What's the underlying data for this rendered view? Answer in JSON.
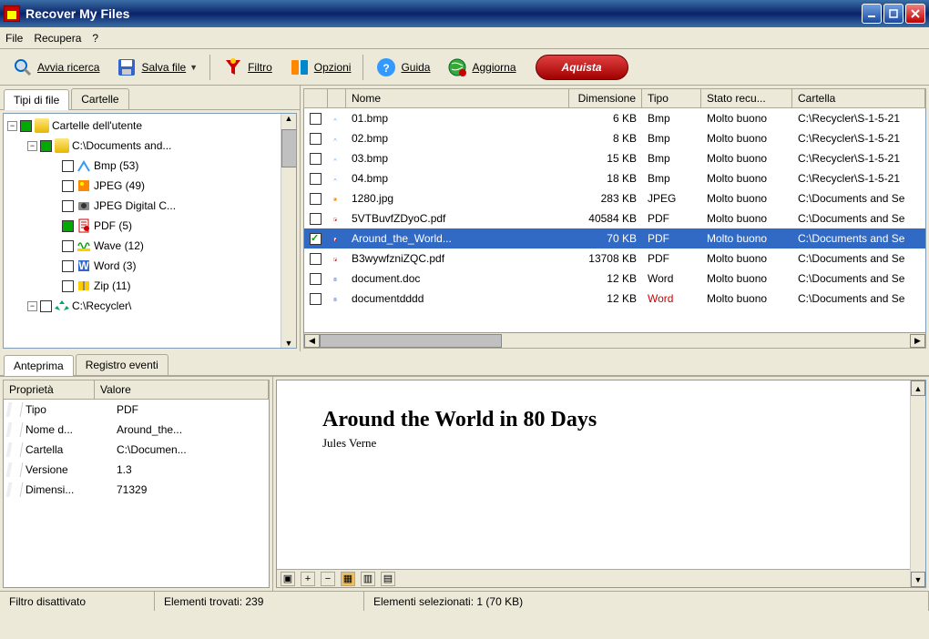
{
  "window": {
    "title": "Recover My Files"
  },
  "menu": {
    "file": "File",
    "recupera": "Recupera",
    "help": "?"
  },
  "toolbar": {
    "avvia": "Avvia ricerca",
    "salva": "Salva file",
    "filtro": "Filtro",
    "opzioni": "Opzioni",
    "guida": "Guida",
    "aggiorna": "Aggiorna",
    "aquista": "Aquista"
  },
  "left_tabs": {
    "tipi": "Tipi di file",
    "cartelle": "Cartelle"
  },
  "tree": {
    "root": "Cartelle dell'utente",
    "docs": "C:\\Documents and...",
    "bmp": "Bmp (53)",
    "jpeg": "JPEG (49)",
    "jpegd": "JPEG Digital C...",
    "pdf": "PDF (5)",
    "wave": "Wave (12)",
    "word": "Word (3)",
    "zip": "Zip (11)",
    "recycler": "C:\\Recycler\\"
  },
  "list_headers": {
    "nome": "Nome",
    "dim": "Dimensione",
    "tipo": "Tipo",
    "stato": "Stato recu...",
    "cartella": "Cartella"
  },
  "files": [
    {
      "name": "01.bmp",
      "size": "6 KB",
      "type": "Bmp",
      "state": "Molto buono",
      "folder": "C:\\Recycler\\S-1-5-21"
    },
    {
      "name": "02.bmp",
      "size": "8 KB",
      "type": "Bmp",
      "state": "Molto buono",
      "folder": "C:\\Recycler\\S-1-5-21"
    },
    {
      "name": "03.bmp",
      "size": "15 KB",
      "type": "Bmp",
      "state": "Molto buono",
      "folder": "C:\\Recycler\\S-1-5-21"
    },
    {
      "name": "04.bmp",
      "size": "18 KB",
      "type": "Bmp",
      "state": "Molto buono",
      "folder": "C:\\Recycler\\S-1-5-21"
    },
    {
      "name": "1280.jpg",
      "size": "283 KB",
      "type": "JPEG",
      "state": "Molto buono",
      "folder": "C:\\Documents and Se"
    },
    {
      "name": "5VTBuvfZDyoC.pdf",
      "size": "40584 KB",
      "type": "PDF",
      "state": "Molto buono",
      "folder": "C:\\Documents and Se"
    },
    {
      "name": "Around_the_World...",
      "size": "70 KB",
      "type": "PDF",
      "state": "Molto buono",
      "folder": "C:\\Documents and Se"
    },
    {
      "name": "B3wywfzniZQC.pdf",
      "size": "13708 KB",
      "type": "PDF",
      "state": "Molto buono",
      "folder": "C:\\Documents and Se"
    },
    {
      "name": "document.doc",
      "size": "12 KB",
      "type": "Word",
      "state": "Molto buono",
      "folder": "C:\\Documents and Se"
    },
    {
      "name": "documentdddd",
      "size": "12 KB",
      "type": "Word",
      "state": "Molto buono",
      "folder": "C:\\Documents and Se"
    }
  ],
  "bottom_tabs": {
    "anteprima": "Anteprima",
    "registro": "Registro eventi"
  },
  "prop_headers": {
    "prop": "Proprietà",
    "val": "Valore"
  },
  "props": [
    {
      "k": "Tipo",
      "v": "PDF"
    },
    {
      "k": "Nome d...",
      "v": "Around_the..."
    },
    {
      "k": "Cartella",
      "v": "C:\\Documen..."
    },
    {
      "k": "Versione",
      "v": "1.3"
    },
    {
      "k": "Dimensi...",
      "v": "71329"
    }
  ],
  "preview": {
    "title": "Around the World in 80 Days",
    "author": "Jules Verne"
  },
  "status": {
    "filtro": "Filtro disattivato",
    "trovati": "Elementi trovati: 239",
    "selezionati": "Elementi selezionati: 1 (70 KB)"
  }
}
